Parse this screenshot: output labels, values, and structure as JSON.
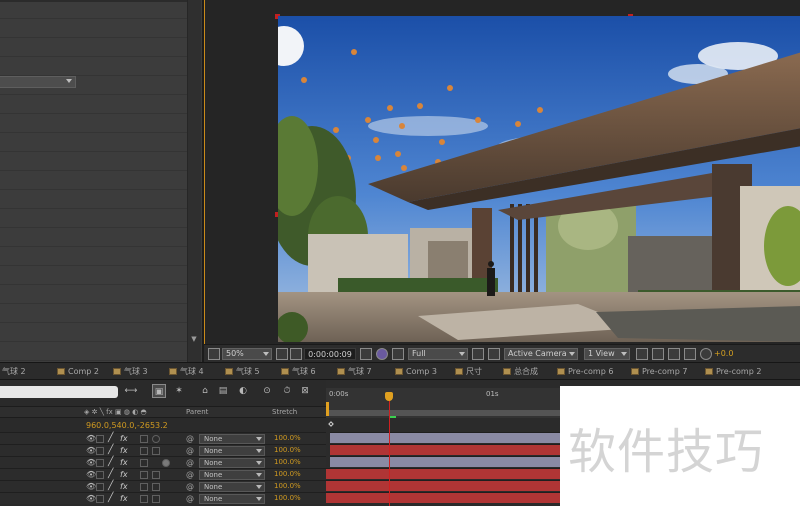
{
  "comp_viewer": {
    "zoom": "50%",
    "timecode": "0:00:00:09",
    "resolution": "Full",
    "camera": "Active Camera",
    "view_layout": "1 View",
    "exposure": "+0.0"
  },
  "tabs": [
    {
      "label": "气球 2"
    },
    {
      "label": "Comp 2"
    },
    {
      "label": "气球 3"
    },
    {
      "label": "气球 4"
    },
    {
      "label": "气球 5"
    },
    {
      "label": "气球 6"
    },
    {
      "label": "气球 7"
    },
    {
      "label": "Comp 3"
    },
    {
      "label": "尺寸"
    },
    {
      "label": "总合成"
    },
    {
      "label": "Pre-comp 6"
    },
    {
      "label": "Pre-comp 7"
    },
    {
      "label": "Pre-comp 2"
    }
  ],
  "timeline": {
    "columns": {
      "parent": "Parent",
      "stretch": "Stretch"
    },
    "ruler_labels": [
      "0:00s",
      "01s"
    ],
    "transform_values": "960.0,540.0,-2653.2",
    "layers": [
      {
        "parent": "None",
        "stretch": "100.0%"
      },
      {
        "parent": "None",
        "stretch": "100.0%"
      },
      {
        "parent": "None",
        "stretch": "100.0%"
      },
      {
        "parent": "None",
        "stretch": "100.0%"
      },
      {
        "parent": "None",
        "stretch": "100.0%"
      },
      {
        "parent": "None",
        "stretch": "100.0%"
      }
    ]
  },
  "watermark": "软件技巧",
  "colors": {
    "accent_orange": "#d09a20",
    "playhead_red": "#d02020",
    "layer_purple": "#8a8aa4",
    "layer_red": "#b03535"
  },
  "icons": [
    "eye-icon",
    "pen-icon",
    "fx-icon",
    "spiral-icon",
    "camera-icon",
    "search-icon"
  ]
}
